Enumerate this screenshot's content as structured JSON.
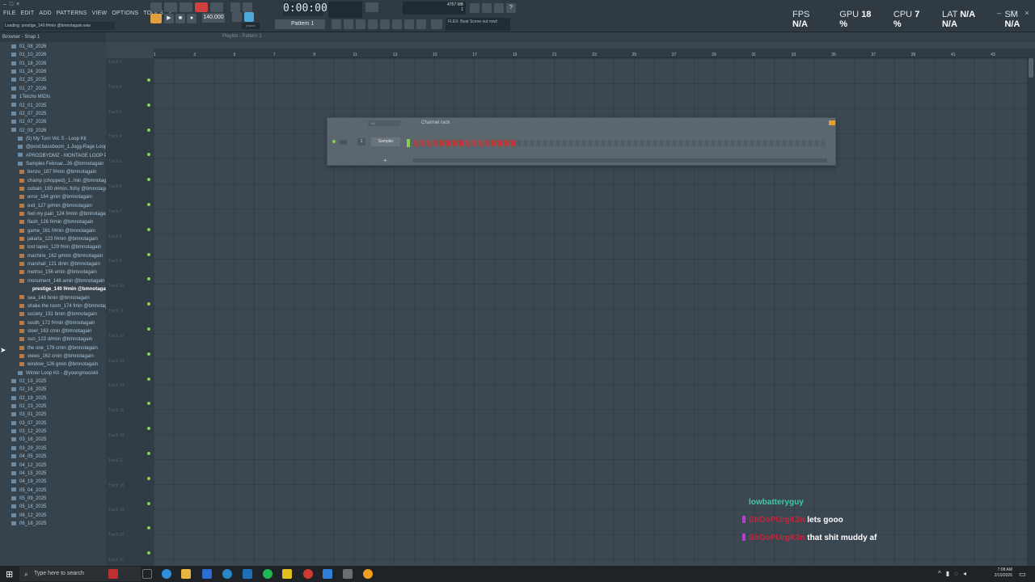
{
  "window": {
    "controls": [
      "–",
      "□",
      "×"
    ],
    "menu": [
      "FILE",
      "EDIT",
      "ADD",
      "PATTERNS",
      "VIEW",
      "OPTIONS",
      "TOOLS",
      "?"
    ],
    "loading_text": "Loading: prestige_140 f#min @bmnotagain.wav"
  },
  "transport": {
    "time": "0:00:00",
    "tempo": "140.000",
    "pattern": "Pattern 1",
    "pattern_none": "(none)",
    "hint": "FLEX: Beat Scene out now!",
    "mem": "4757 MB",
    "mem_sub": "1"
  },
  "stats": {
    "fps_label": "FPS",
    "fps_value": "N/A",
    "gpu_label": "GPU",
    "gpu_value": "18 %",
    "cpu_label": "CPU",
    "cpu_value": "7 %",
    "lat_label": "LAT",
    "lat_value1": "N/A",
    "lat_value2": "N/A",
    "sm_label": "SM",
    "sm_value": "N/A"
  },
  "window_buttons": [
    "–",
    "□",
    "×"
  ],
  "browser": {
    "header": "Browser - Snap 1",
    "items": [
      {
        "label": "01_08_2026",
        "kind": "folder",
        "indent": 1
      },
      {
        "label": "01_10_2026",
        "kind": "folder",
        "indent": 1
      },
      {
        "label": "01_18_2026",
        "kind": "folder",
        "indent": 1
      },
      {
        "label": "01_24_2026",
        "kind": "folder",
        "indent": 1
      },
      {
        "label": "01_25_2025",
        "kind": "folder",
        "indent": 1
      },
      {
        "label": "01_27_2026",
        "kind": "folder",
        "indent": 1
      },
      {
        "label": "1Tetcho MIDIs",
        "kind": "folder",
        "indent": 1
      },
      {
        "label": "02_01_2025",
        "kind": "folder",
        "indent": 1
      },
      {
        "label": "02_07_2025",
        "kind": "folder",
        "indent": 1
      },
      {
        "label": "02_07_2026",
        "kind": "folder",
        "indent": 1
      },
      {
        "label": "02_09_2026",
        "kind": "open",
        "indent": 1
      },
      {
        "label": "(5) My Turn Vol. 5 - Loop Kit",
        "kind": "folder",
        "indent": 2
      },
      {
        "label": "@prod.bassboom_1.Jugg-Rage Loops",
        "kind": "folder",
        "indent": 2
      },
      {
        "label": "#PRODBYDMZ - MONTAGE LOOP PACK",
        "kind": "folder",
        "indent": 2
      },
      {
        "label": "Samples Februar...26 @bmnotagain",
        "kind": "folder",
        "indent": 2
      },
      {
        "label": "benzo_187 f#min @bmnotagain",
        "kind": "file",
        "indent": 3
      },
      {
        "label": "champ (chopped)_1..min @bmnotagain",
        "kind": "file",
        "indent": 3
      },
      {
        "label": "cobain_160 d#min..fishy @bmnotagain",
        "kind": "file",
        "indent": 3
      },
      {
        "label": "error_164 gmin @bmnotagain",
        "kind": "file",
        "indent": 3
      },
      {
        "label": "exit_127 g#min @bmnotagain",
        "kind": "file",
        "indent": 3
      },
      {
        "label": "feel my pain_124 f#min @bmnotagain",
        "kind": "file",
        "indent": 3
      },
      {
        "label": "flash_126 f#min @bmnotagain",
        "kind": "file",
        "indent": 3
      },
      {
        "label": "game_161 f#min @bmnotagain",
        "kind": "file",
        "indent": 3
      },
      {
        "label": "jakarta_123 f#min @bmnotagain",
        "kind": "file",
        "indent": 3
      },
      {
        "label": "lost tapes_129 fmin @bmnotagain",
        "kind": "file",
        "indent": 3
      },
      {
        "label": "machine_162 g#min @bmnotagain",
        "kind": "file",
        "indent": 3
      },
      {
        "label": "marshall_121 dmin @bmnotagain",
        "kind": "file",
        "indent": 3
      },
      {
        "label": "metroo_156 emin @bmnotagain",
        "kind": "file",
        "indent": 3
      },
      {
        "label": "monument_148 amin @bmnotagain",
        "kind": "file",
        "indent": 3
      },
      {
        "label": "prestige_140 f#min @bmnotagain",
        "kind": "sel",
        "indent": 4
      },
      {
        "label": "sea_148 bmin @bmnotagain",
        "kind": "file",
        "indent": 3
      },
      {
        "label": "shake the room_174 fmin @bmnotagain",
        "kind": "file",
        "indent": 3
      },
      {
        "label": "society_151 bmin @bmnotagain",
        "kind": "file",
        "indent": 3
      },
      {
        "label": "south_172 f#min @bmnotagain",
        "kind": "file",
        "indent": 3
      },
      {
        "label": "steel_163 cmin @bmnotagain",
        "kind": "file",
        "indent": 3
      },
      {
        "label": "sun_123 d#min @bmnotagain",
        "kind": "file",
        "indent": 3
      },
      {
        "label": "the one_179 cmin @bmnotagain",
        "kind": "file",
        "indent": 3
      },
      {
        "label": "views_162 cmin @bmnotagain",
        "kind": "file",
        "indent": 3
      },
      {
        "label": "window_126 gmin @bmnotagain",
        "kind": "file",
        "indent": 3
      },
      {
        "label": "Winter Loop Kit - @youngmooskii",
        "kind": "folder",
        "indent": 2
      },
      {
        "label": "02_13_2025",
        "kind": "folder",
        "indent": 1
      },
      {
        "label": "02_16_2025",
        "kind": "folder",
        "indent": 1
      },
      {
        "label": "02_19_2025",
        "kind": "folder",
        "indent": 1
      },
      {
        "label": "02_23_2025",
        "kind": "folder",
        "indent": 1
      },
      {
        "label": "03_01_2025",
        "kind": "folder",
        "indent": 1
      },
      {
        "label": "03_07_2025",
        "kind": "folder",
        "indent": 1
      },
      {
        "label": "03_12_2025",
        "kind": "folder",
        "indent": 1
      },
      {
        "label": "03_16_2025",
        "kind": "folder",
        "indent": 1
      },
      {
        "label": "03_29_2025",
        "kind": "folder",
        "indent": 1
      },
      {
        "label": "04_05_2025",
        "kind": "folder",
        "indent": 1
      },
      {
        "label": "04_12_2025",
        "kind": "folder",
        "indent": 1
      },
      {
        "label": "04_15_2025",
        "kind": "folder",
        "indent": 1
      },
      {
        "label": "04_19_2025",
        "kind": "folder",
        "indent": 1
      },
      {
        "label": "05_04_2025",
        "kind": "folder",
        "indent": 1
      },
      {
        "label": "05_09_2025",
        "kind": "folder",
        "indent": 1
      },
      {
        "label": "05_18_2025",
        "kind": "folder",
        "indent": 1
      },
      {
        "label": "06_12_2025",
        "kind": "folder",
        "indent": 1
      },
      {
        "label": "06_18_2025",
        "kind": "folder",
        "indent": 1
      }
    ]
  },
  "playlist": {
    "title": "Playlist - Pattern 1",
    "ruler": [
      "1",
      "3",
      "5",
      "7",
      "9",
      "11",
      "13",
      "15",
      "17",
      "19",
      "21",
      "23",
      "25",
      "27",
      "29",
      "31",
      "33",
      "35",
      "37",
      "39",
      "41",
      "43"
    ],
    "tracks": [
      "Track 1",
      "Track 2",
      "Track 3",
      "Track 4",
      "Track 5",
      "Track 6",
      "Track 7",
      "Track 8",
      "Track 9",
      "Track 10",
      "Track 11",
      "Track 12",
      "Track 13",
      "Track 14",
      "Track 15",
      "Track 16",
      "Track 17",
      "Track 18",
      "Track 19",
      "Track 20",
      "Track 21"
    ]
  },
  "channel_rack": {
    "title": "Channel rack",
    "filter": "All",
    "channel_number": "1",
    "channel_name": "Sampler",
    "add": "+",
    "step_count": 64,
    "active_steps": 16
  },
  "chat": [
    {
      "user": "lowbatteryguy",
      "message": "",
      "user_color": "#3ec9a8"
    },
    {
      "user": "ShOoPUrgK3n",
      "message": "lets gooo",
      "user_color": "#d0203a"
    },
    {
      "user": "ShOoPUrgK3n",
      "message": "that shit muddy af",
      "user_color": "#d0203a"
    }
  ],
  "taskbar": {
    "search_placeholder": "Type here to search",
    "time": "7:08 AM",
    "date": "2/10/2026"
  },
  "colors": {
    "accent_green": "#8ad04c",
    "step_red": "#b23a3a",
    "browser_text": "#a8c3d8"
  }
}
